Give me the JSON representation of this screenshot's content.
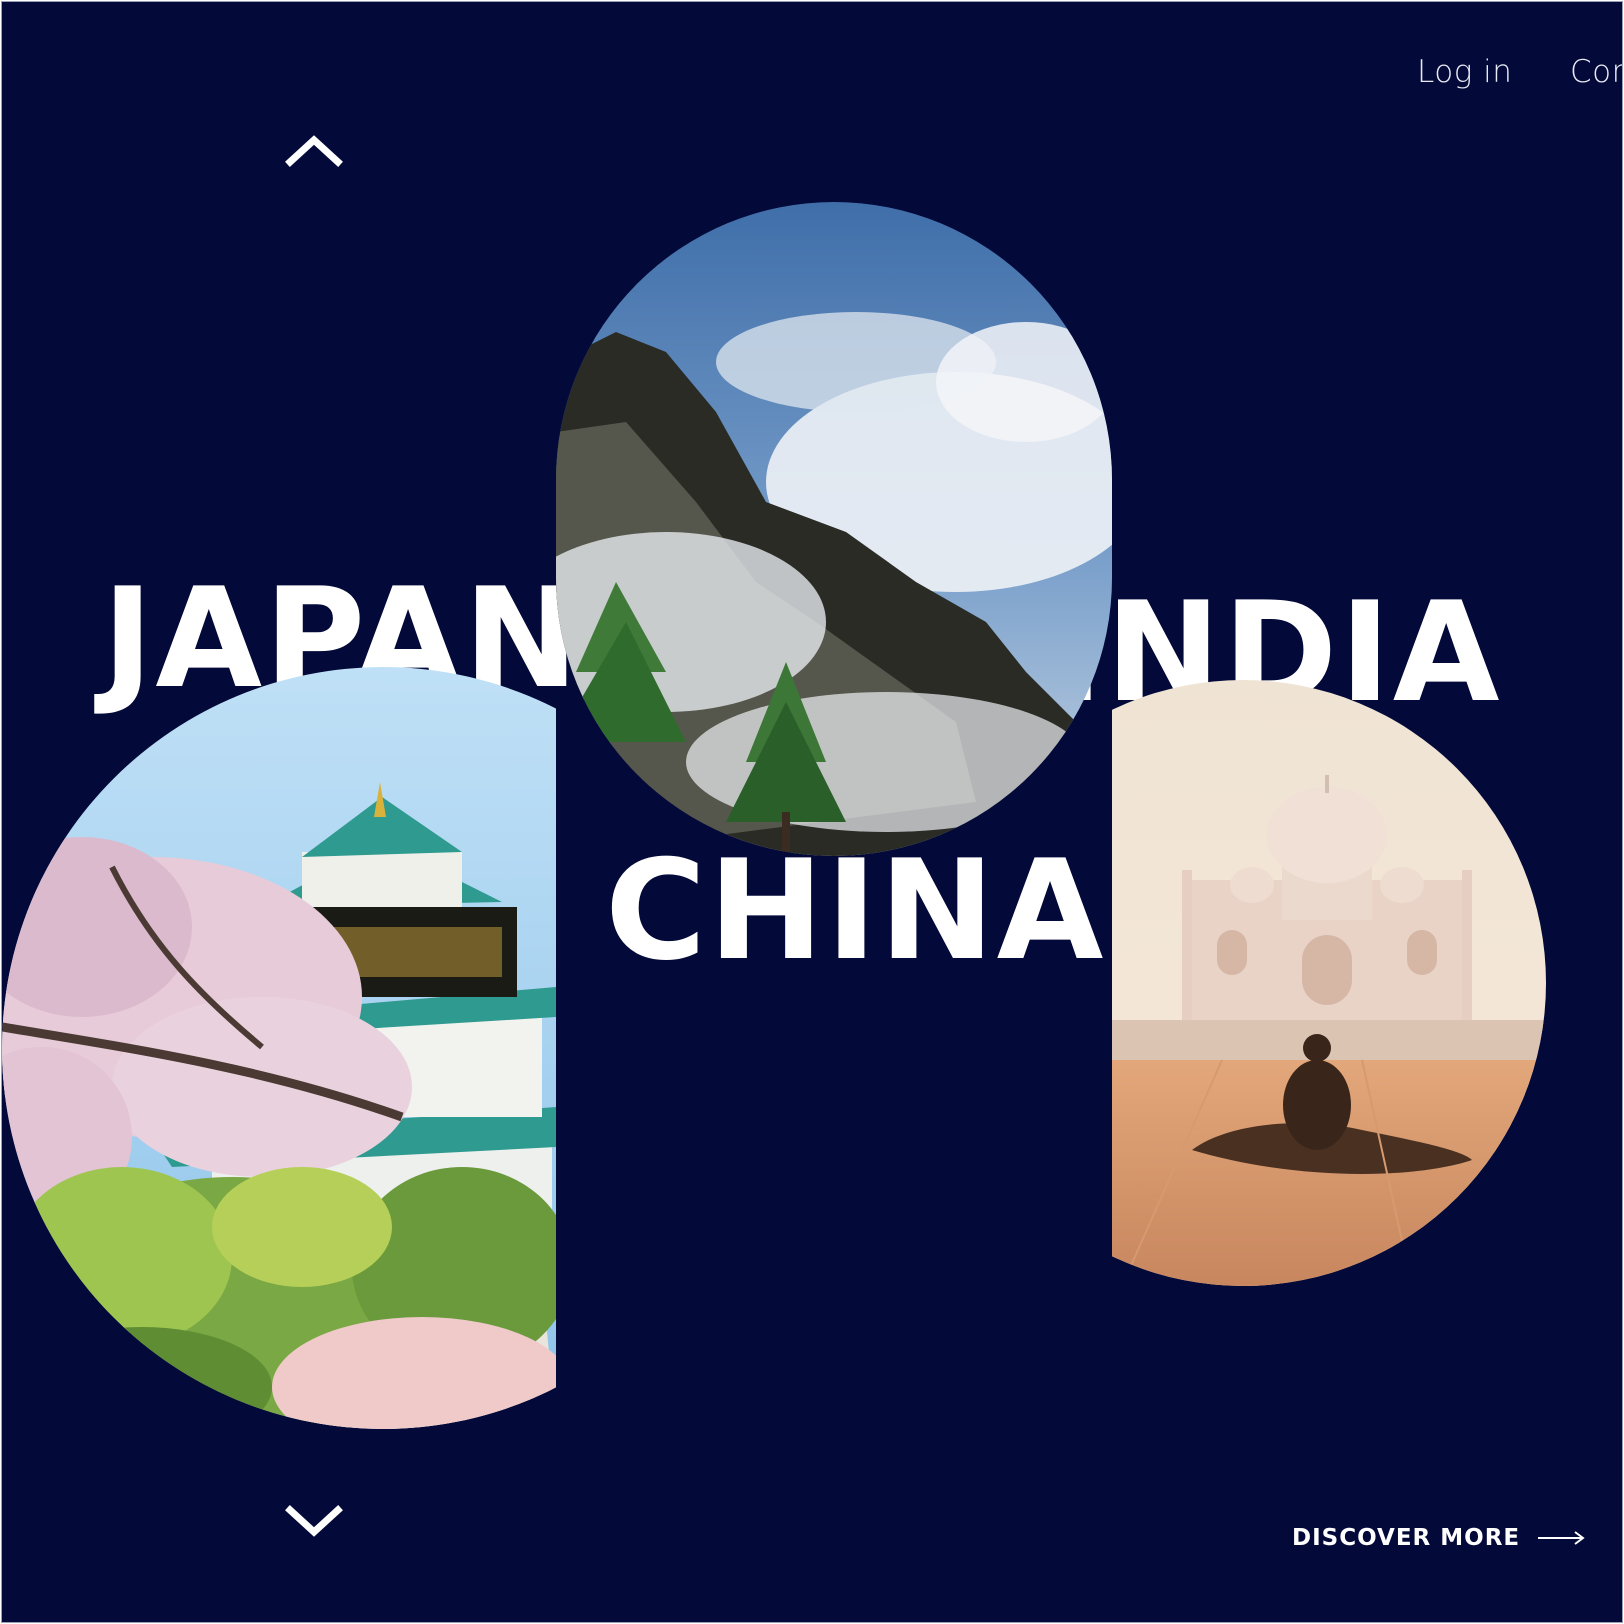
{
  "nav": {
    "login": "Log in",
    "contact": "Con"
  },
  "countries": {
    "japan": "JAPAN",
    "china": "CHINA",
    "india": "INDIA"
  },
  "cta": {
    "discover": "DISCOVER MORE"
  },
  "icons": {
    "up": "chevron-up-icon",
    "down": "chevron-down-icon",
    "arrow": "arrow-right-icon"
  },
  "colors": {
    "background": "#030938",
    "text": "#ffffff"
  }
}
